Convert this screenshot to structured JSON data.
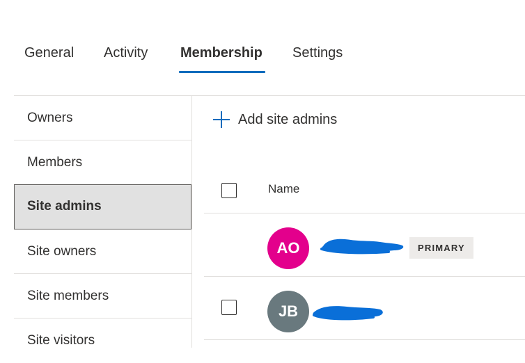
{
  "tabs": [
    {
      "label": "General"
    },
    {
      "label": "Activity"
    },
    {
      "label": "Membership",
      "active": true
    },
    {
      "label": "Settings"
    }
  ],
  "nav": {
    "items": [
      {
        "label": "Owners"
      },
      {
        "label": "Members"
      },
      {
        "label": "Site admins",
        "selected": true
      },
      {
        "label": "Site owners"
      },
      {
        "label": "Site members"
      },
      {
        "label": "Site visitors"
      }
    ]
  },
  "toolbar": {
    "add_label": "Add site admins",
    "add_icon": "plus-icon"
  },
  "table": {
    "header": {
      "name": "Name"
    },
    "rows": [
      {
        "initials": "AO",
        "avatar_color": "#e3008c",
        "name_redacted": true,
        "badge": "PRIMARY",
        "checkbox_visible": false
      },
      {
        "initials": "JB",
        "avatar_color": "#69797e",
        "name_redacted": true,
        "checkbox_visible": true
      }
    ]
  },
  "colors": {
    "accent": "#0f6cbd",
    "redaction": "#0a6fd8",
    "selected_bg": "#e1e1e1"
  }
}
